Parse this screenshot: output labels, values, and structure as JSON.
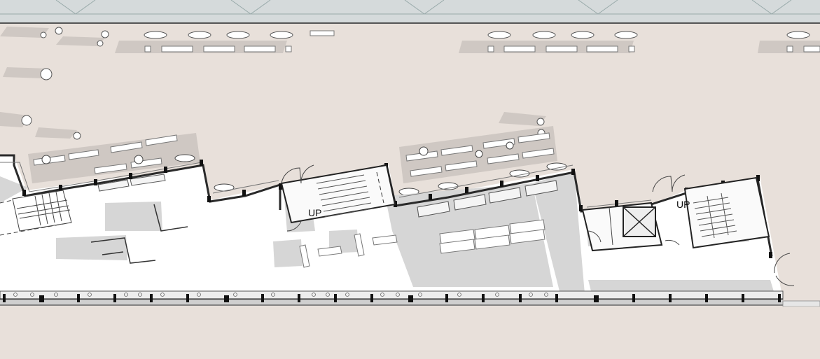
{
  "drawing": {
    "type": "architectural floor plan",
    "stair_labels": [
      "UP",
      "UP"
    ]
  },
  "colors": {
    "ground": "#e8e0da",
    "floor": "#ffffff",
    "roof": "#d5dadb",
    "wall": "#2a2a2a",
    "shadow": "#c9c3bf"
  }
}
